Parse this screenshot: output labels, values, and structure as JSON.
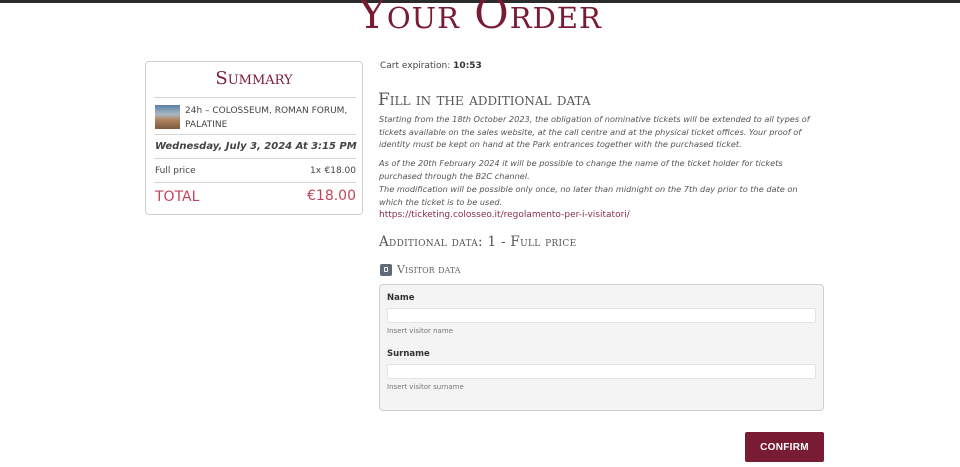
{
  "page": {
    "title": "Your Order"
  },
  "summary": {
    "title": "Summary",
    "product_name": "24h – COLOSSEUM, ROMAN FORUM, PALATINE",
    "date": "Wednesday, July 3, 2024 At 3:15 PM",
    "line_label": "Full price",
    "line_qty": "1x",
    "line_price": "€18.00",
    "total_label": "TOTAL",
    "total_value": "€18.00"
  },
  "cart": {
    "label": "Cart expiration:",
    "time": "10:53"
  },
  "additional": {
    "title": "Fill in the additional data",
    "p1": "Starting from the 18th October 2023, the obligation of nominative tickets will be extended to all types of tickets available on the sales website, at the call centre and at the physical ticket offices. Your proof of identity must be kept on hand at the Park entrances together with the purchased ticket.",
    "p2": "As of the 20th February 2024 it will be possible to change the name of the ticket holder for tickets purchased through the B2C channel.",
    "p3": "The modification will be possible only once, no later than midnight on the 7th day prior to the date on which the ticket is to be used.",
    "link": "https://ticketing.colosseo.it/regolamento-per-i-visitatori/",
    "data_title": "Additional data: 1 - Full price"
  },
  "visitor": {
    "section_label": "Visitor data",
    "icon": "id-card-icon",
    "name_label": "Name",
    "name_value": "",
    "name_help": "Insert visitor name",
    "surname_label": "Surname",
    "surname_value": "",
    "surname_help": "Insert visitor surname"
  },
  "actions": {
    "confirm": "CONFIRM"
  },
  "colors": {
    "brand": "#7a1b34",
    "total": "#c3435a"
  }
}
